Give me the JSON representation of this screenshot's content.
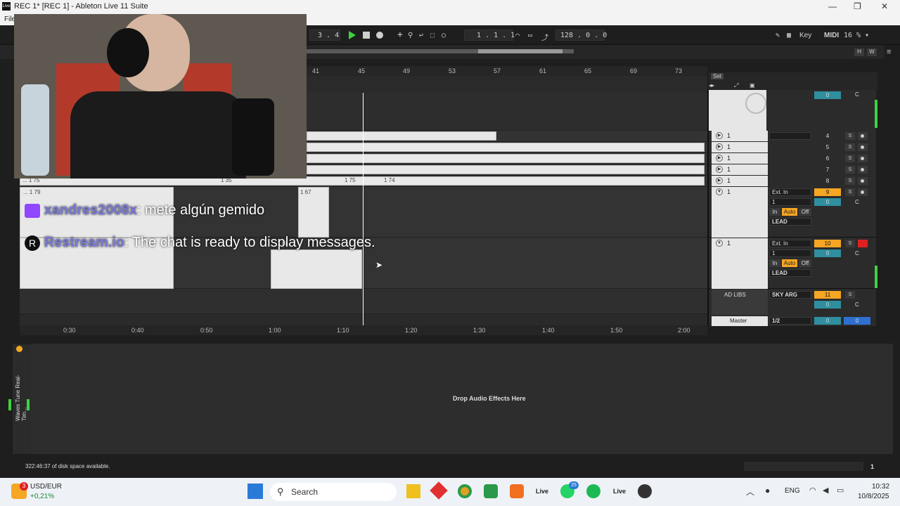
{
  "window": {
    "title": "REC 1*  [REC 1] - Ableton Live 11 Suite",
    "menu_first": "File"
  },
  "control_bar": {
    "meter": "3 . 4",
    "position": "1 .  1 .  1",
    "tempo_pos": "128 .  0 .  0",
    "key_label": "Key",
    "midi_label": "MIDI",
    "cpu": "16 %",
    "h_label": "H",
    "w_label": "W"
  },
  "beat_ruler": [
    "41",
    "45",
    "49",
    "53",
    "57",
    "61",
    "65",
    "69",
    "73"
  ],
  "arrangement": {
    "clip_labels": [
      "... 1 75",
      "1 35",
      "1 75",
      "1 74",
      "... 1 79",
      "1 67",
      "1 68"
    ],
    "set_label": "Set"
  },
  "time_ruler": [
    "0:30",
    "0:40",
    "0:50",
    "1:00",
    "1:10",
    "1:20",
    "1:30",
    "1:40",
    "1:50",
    "2:00"
  ],
  "mixer": {
    "rows": [
      {
        "name": "1",
        "num": "4"
      },
      {
        "name": "1",
        "num": "5"
      },
      {
        "name": "1",
        "num": "6"
      },
      {
        "name": "1",
        "num": "7"
      },
      {
        "name": "1",
        "num": "8"
      }
    ],
    "lead1": {
      "name": "1",
      "input": "Ext. In",
      "channel": "1",
      "track": "9",
      "vol": "0",
      "pan": "C",
      "in_label": "In",
      "auto_label": "Auto",
      "off_label": "Off",
      "output": "LEAD"
    },
    "lead2": {
      "name": "1",
      "input": "Ext. In",
      "channel": "1",
      "track": "10",
      "vol": "0",
      "pan": "C",
      "in_label": "In",
      "auto_label": "Auto",
      "off_label": "Off",
      "output": "LEAD"
    },
    "adlibs": {
      "name": "AD LIBS",
      "output": "SKY ARG",
      "track": "11",
      "vol": "0",
      "pan": "C"
    },
    "master": {
      "name": "Master",
      "output": "1/2",
      "vol": "0",
      "vol2": "0"
    },
    "top": {
      "vol": "0",
      "pan": "C"
    },
    "solo_label": "S"
  },
  "chat": {
    "msg1_user": "xandres2008x",
    "msg1_text": ": mete algún gemido",
    "msg2_user": "Restream.io",
    "msg2_text": ": The chat is ready to display messages."
  },
  "device": {
    "drop_text": "Drop Audio Effects Here",
    "plugin_name": "Waves Tune Real-Tim..."
  },
  "status": {
    "disk": "322:46:37 of disk space available.",
    "right_num": "1"
  },
  "taskbar": {
    "widget_title": "USD/EUR",
    "widget_value": "+0,21%",
    "widget_badge": "3",
    "search": "Search",
    "live_label": "Live",
    "whatsapp_badge": "25",
    "lang": "ENG",
    "time": "10:32",
    "date": "10/8/2025",
    "colors": {
      "accent_orange": "#f5a623",
      "play_green": "#3fd23f",
      "rec_red": "#e02020"
    }
  }
}
